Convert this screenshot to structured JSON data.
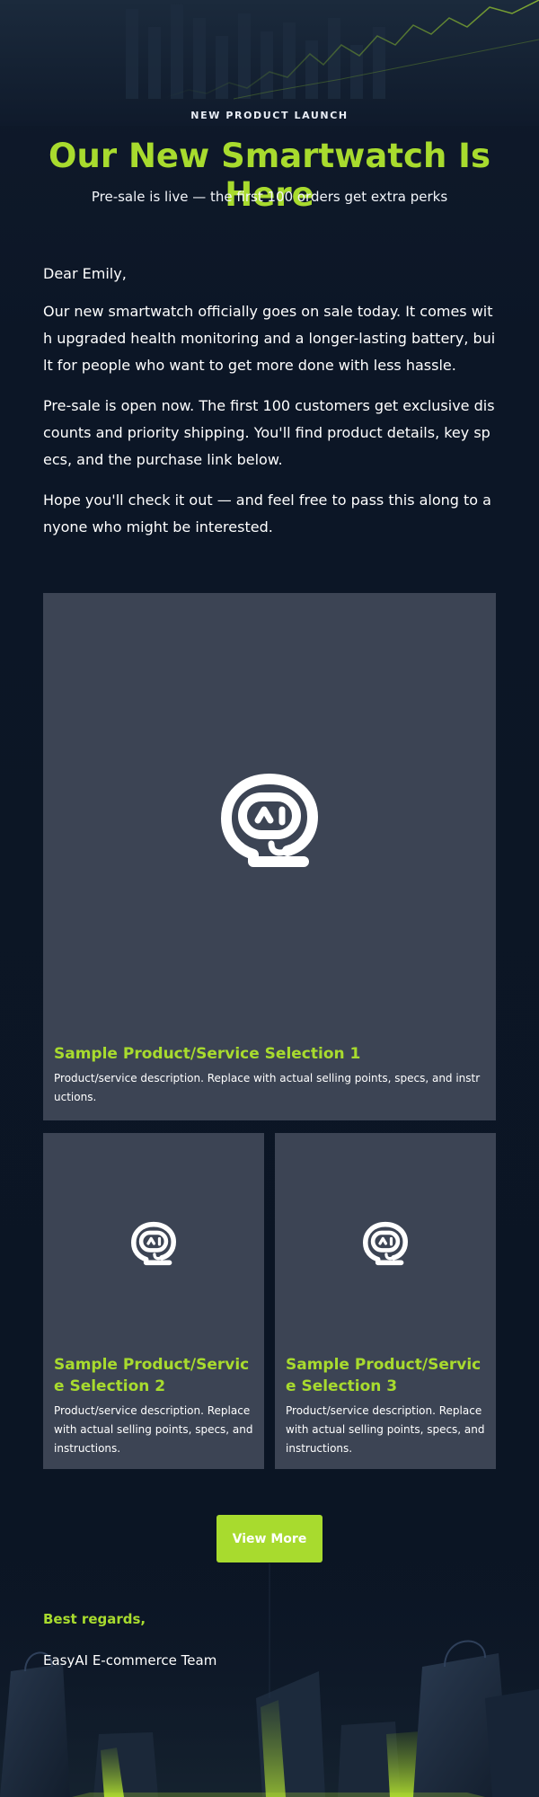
{
  "hero": {
    "eyebrow": "NEW PRODUCT LAUNCH",
    "title": "Our New Smartwatch Is Here",
    "subtitle": "Pre-sale is live — the first 100 orders get extra perks"
  },
  "letter": {
    "greeting": "Dear Emily,",
    "paragraphs": [
      "Our new smartwatch officially goes on sale today. It comes with upgraded health monitoring and a longer-lasting battery, built for people who want to get more done with less hassle.",
      "Pre-sale is open now. The first 100 customers get exclusive discounts and priority shipping. You'll find product details, key specs, and the purchase link below.",
      "Hope you'll check it out — and feel free to pass this along to anyone who might be interested."
    ]
  },
  "products": [
    {
      "title": "Sample Product/Service Selection 1",
      "description": "Product/service description. Replace with actual selling points, specs, and instructions.",
      "icon": "robot-chat-icon"
    },
    {
      "title": "Sample Product/Service Selection 2",
      "description": "Product/service description. Replace with actual selling points, specs, and instructions.",
      "icon": "robot-chat-icon"
    },
    {
      "title": "Sample Product/Service Selection 3",
      "description": "Product/service description. Replace with actual selling points, specs, and instructions.",
      "icon": "robot-chat-icon"
    }
  ],
  "cta": {
    "label": "View More"
  },
  "signoff": {
    "regards": "Best regards,",
    "team": "EasyAI E-commerce Team"
  },
  "colors": {
    "accent": "#a8db2e",
    "background": "#0d1525",
    "card": "#3c4454",
    "text": "#ffffff"
  }
}
